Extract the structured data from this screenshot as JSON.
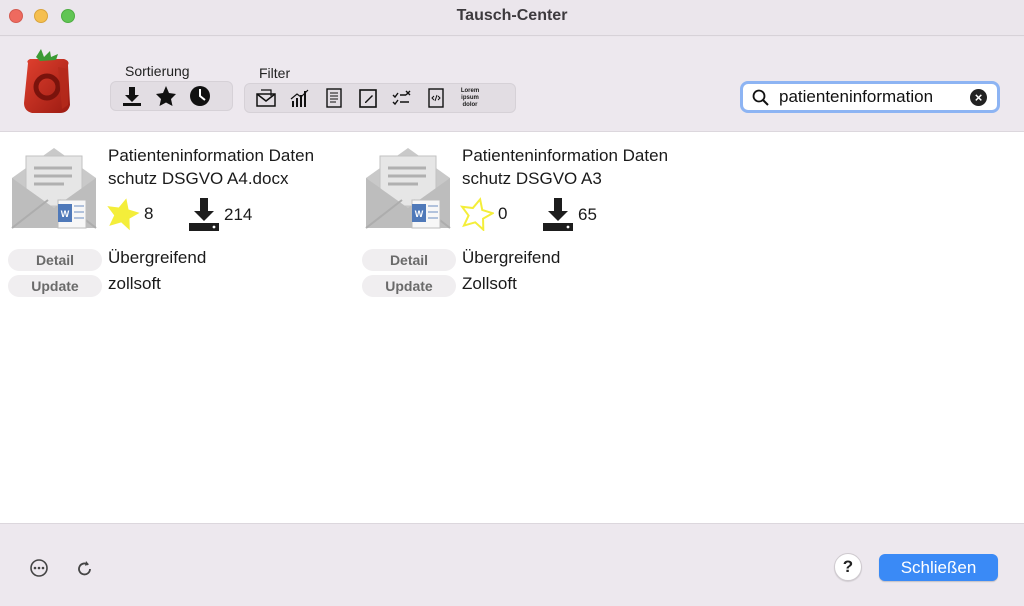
{
  "window": {
    "title": "Tausch-Center"
  },
  "toolbar": {
    "sort_label": "Sortierung",
    "sort_buttons": [
      "download-icon",
      "star-icon",
      "clock-icon"
    ],
    "filter_label": "Filter",
    "filter_buttons": [
      "mail-icon",
      "chart-icon",
      "text-document-icon",
      "edit-document-icon",
      "checklist-icon",
      "code-document-icon",
      "lorem-ipsum-icon"
    ],
    "lorem_icon_text": "Lorem ipsum dolor"
  },
  "search": {
    "value": "patienteninformation",
    "clear_icon": "clear-icon"
  },
  "results": [
    {
      "title": "Patienteninformation Datenschutz DSGVO A4.docx",
      "title_line1": "Patienteninformation Daten",
      "title_line2": "schutz DSGVO A4.docx",
      "rating": "8",
      "rating_filled": true,
      "downloads": "214",
      "detail_label": "Detail",
      "update_label": "Update",
      "category": "Übergreifend",
      "author": "zollsoft"
    },
    {
      "title": "Patienteninformation Datenschutz DSGVO A3",
      "title_line1": "Patienteninformation Daten",
      "title_line2": "schutz DSGVO A3",
      "rating": "0",
      "rating_filled": false,
      "downloads": "65",
      "detail_label": "Detail",
      "update_label": "Update",
      "category": "Übergreifend",
      "author": "Zollsoft"
    }
  ],
  "footer": {
    "more_icon": "more-icon",
    "refresh_icon": "refresh-icon",
    "help_label": "?",
    "close_label": "Schließen"
  },
  "colors": {
    "accent": "#3a8af6",
    "star": "#f4ee3a",
    "search_focus": "#8db4f3"
  }
}
